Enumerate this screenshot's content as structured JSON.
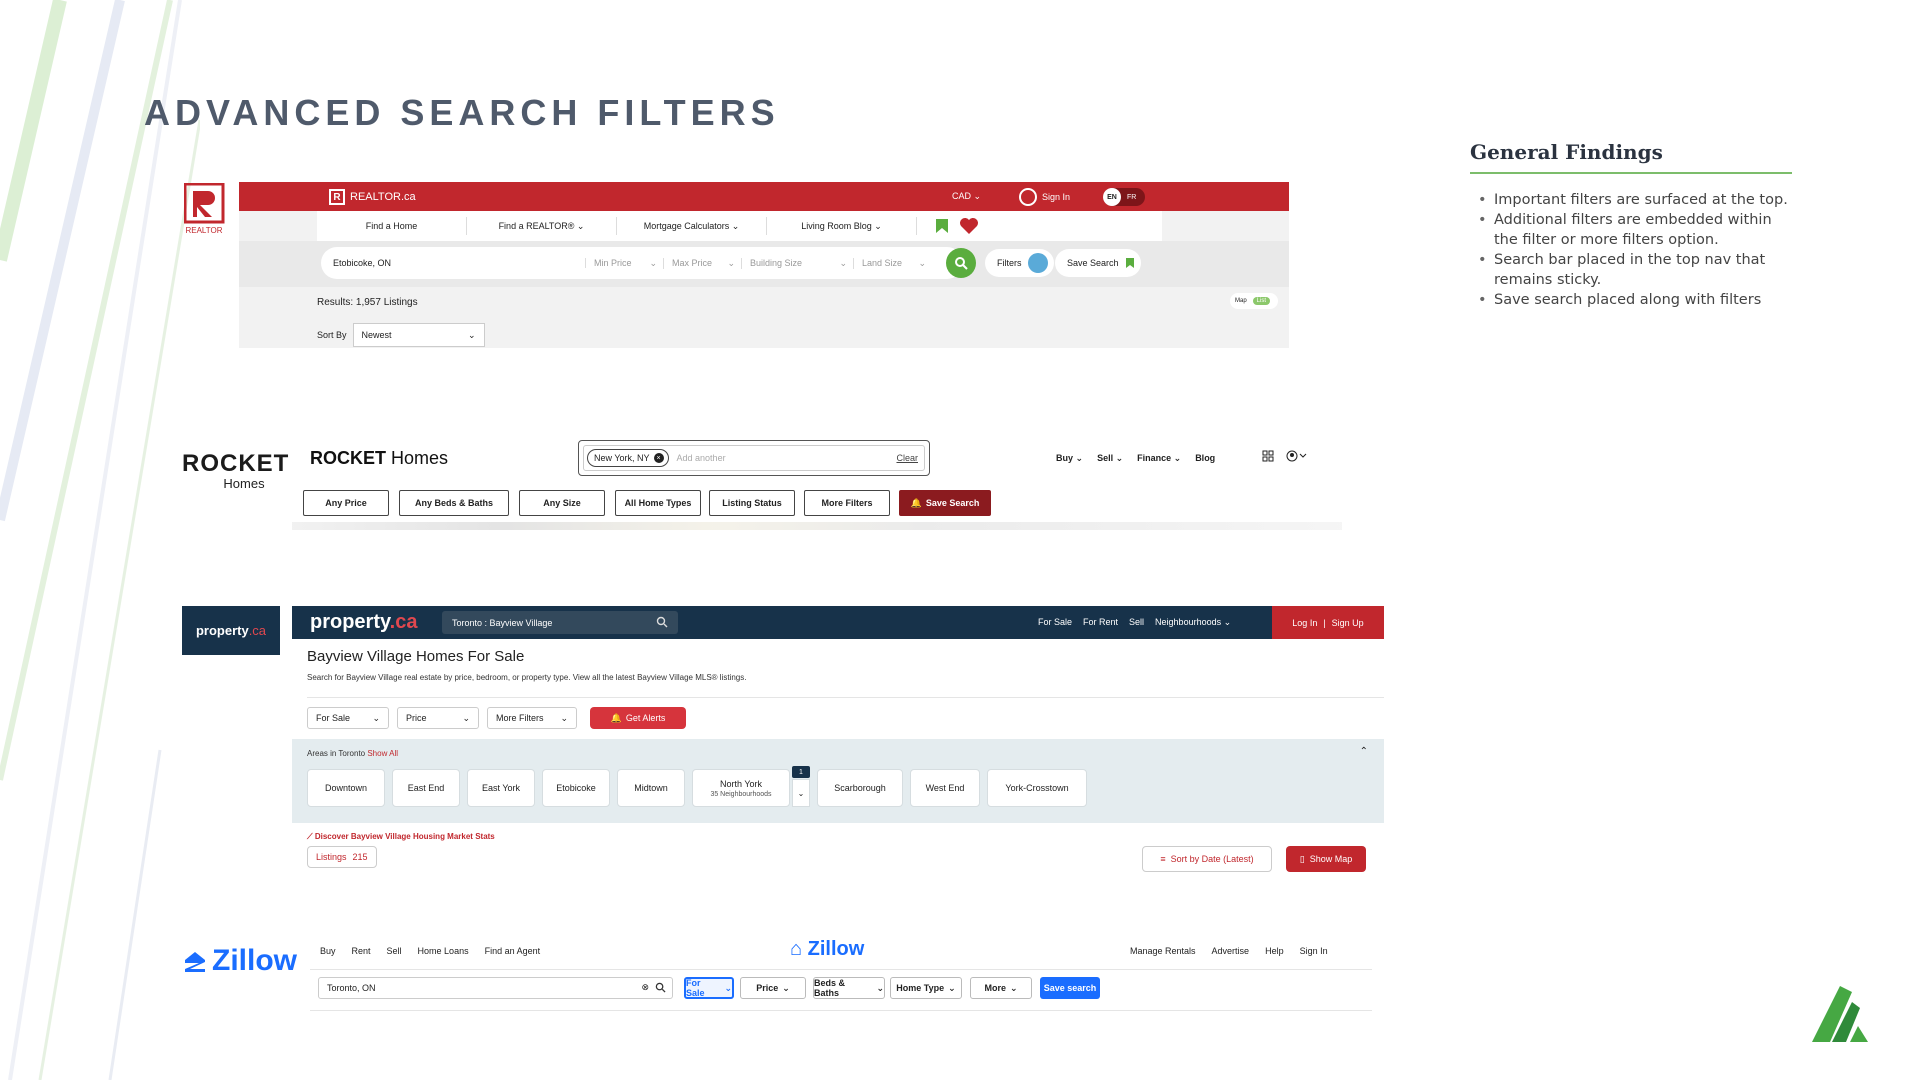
{
  "slide": {
    "title": "ADVANCED SEARCH FILTERS"
  },
  "findings": {
    "heading": "General Findings",
    "bullets": [
      "Important filters are surfaced at the top.",
      "Additional filters are embedded within the filter or more filters option.",
      "Search bar placed in the top nav that remains sticky.",
      "Save search placed along with filters"
    ]
  },
  "logos": {
    "realtor": "REALTOR",
    "rocket_main": "ROCKET",
    "rocket_sub": "Homes",
    "property_main": "property",
    "property_accent": ".ca",
    "zillow": "Zillow"
  },
  "realtor": {
    "brand": "REALTOR.ca",
    "currency": "CAD",
    "sign_in": "Sign In",
    "lang_en": "EN",
    "lang_fr": "FR",
    "nav": [
      "Find a Home",
      "Find a REALTOR®",
      "Mortgage Calculators",
      "Living Room Blog"
    ],
    "location": "Etobicoke, ON",
    "filters": [
      "Min Price",
      "Max Price",
      "Building Size",
      "Land Size"
    ],
    "filters_label": "Filters",
    "save_search": "Save Search",
    "results": "Results: 1,957 Listings",
    "sort_by": "Sort By",
    "sort_value": "Newest",
    "map": "Map",
    "list": "List"
  },
  "rocket": {
    "brand_bold": "ROCKET",
    "brand_thin": "Homes",
    "chip": "New York, NY",
    "add_another": "Add another",
    "clear": "Clear",
    "nav": [
      "Buy",
      "Sell",
      "Finance",
      "Blog"
    ],
    "filters": [
      "Any Price",
      "Any Beds & Baths",
      "Any Size",
      "All Home Types",
      "Listing Status",
      "More Filters"
    ],
    "save_search": "Save Search"
  },
  "property": {
    "brand_main": "property",
    "brand_accent": ".ca",
    "search_value": "Toronto : Bayview Village",
    "nav": [
      "For Sale",
      "For Rent",
      "Sell",
      "Neighbourhoods"
    ],
    "log_in": "Log In",
    "sign_up": "Sign Up",
    "separator": "|",
    "heading": "Bayview Village Homes For Sale",
    "subheading": "Search for Bayview Village real estate by price, bedroom, or property type. View all the latest Bayview Village MLS® listings.",
    "filters": [
      "For Sale",
      "Price",
      "More Filters"
    ],
    "get_alerts": "Get Alerts",
    "areas_label": "Areas in Toronto",
    "show_all": "Show All",
    "areas": [
      "Downtown",
      "East End",
      "East York",
      "Etobicoke",
      "Midtown",
      "North York",
      "Scarborough",
      "West End",
      "York-Crosstown"
    ],
    "north_york_sub": "35 Neighbourhoods",
    "badge": "1",
    "market_stats": "Discover Bayview Village Housing Market Stats",
    "listings_label": "Listings",
    "listings_count": "215",
    "sort": "Sort by Date (Latest)",
    "show_map": "Show Map"
  },
  "zillow": {
    "nav_left": [
      "Buy",
      "Rent",
      "Sell",
      "Home Loans",
      "Find an Agent"
    ],
    "brand": "Zillow",
    "nav_right": [
      "Manage Rentals",
      "Advertise",
      "Help",
      "Sign In"
    ],
    "search_value": "Toronto, ON",
    "filters": [
      "For Sale",
      "Price",
      "Beds & Baths",
      "Home Type",
      "More"
    ],
    "save_search": "Save search"
  },
  "colors": {
    "realtor_red": "#c1272d",
    "rocket_maroon": "#8b1b1f",
    "property_navy": "#17324a",
    "zillow_blue": "#1a6dff",
    "accent_green": "#7cbd6b"
  }
}
